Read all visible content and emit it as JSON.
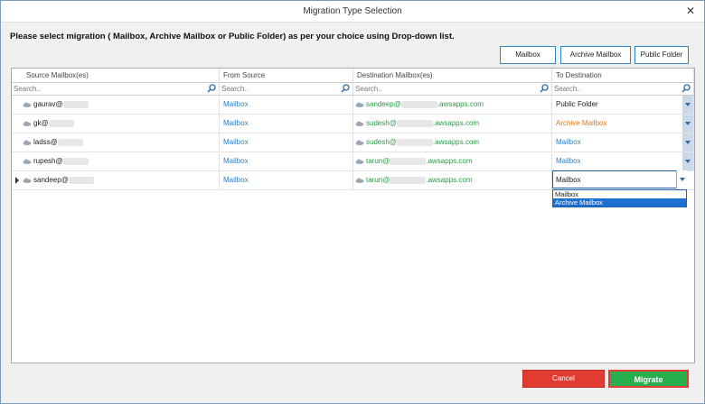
{
  "window": {
    "title": "Migration Type Selection",
    "close_glyph": "✕"
  },
  "instruction": "Please select migration ( Mailbox, Archive Mailbox or Public Folder) as per your choice using Drop-down list.",
  "top_buttons": {
    "mailbox": "Mailbox",
    "archive": "Archive Mailbox",
    "public": "Public Folder"
  },
  "columns": {
    "source": "Source Mailbox(es)",
    "from_source": "From Source",
    "destination": "Destination Mailbox(es)",
    "to_destination": "To Destination"
  },
  "search_placeholder": "Search..",
  "rows": [
    {
      "source": "gaurav@",
      "from": "Mailbox",
      "dest_user": "sandeep@",
      "dest_domain": ".awsapps.com",
      "to": "Public Folder"
    },
    {
      "source": "gk@",
      "from": "Mailbox",
      "dest_user": "sudesh@",
      "dest_domain": ".awsapps.com",
      "to": "Archive Mailbox"
    },
    {
      "source": "ladss@",
      "from": "Mailbox",
      "dest_user": "sudesh@",
      "dest_domain": ".awsapps.com",
      "to": "Mailbox"
    },
    {
      "source": "rupesh@",
      "from": "Mailbox",
      "dest_user": "tarun@",
      "dest_domain": ".awsapps.com",
      "to": "Mailbox"
    },
    {
      "source": "sandeep@",
      "from": "Mailbox",
      "dest_user": "tarun@",
      "dest_domain": ".awsapps.com",
      "to": "Mailbox"
    }
  ],
  "dropdown_options": [
    "Mailbox",
    "Archive Mailbox"
  ],
  "footer": {
    "cancel": "Cancel",
    "migrate": "Migrate"
  },
  "colors": {
    "accent": "#2e86c8",
    "cancel": "#e03c31",
    "migrate": "#27ae4f",
    "link_blue": "#2d7fc1",
    "green": "#2d9a47",
    "orange": "#d97a1a"
  }
}
